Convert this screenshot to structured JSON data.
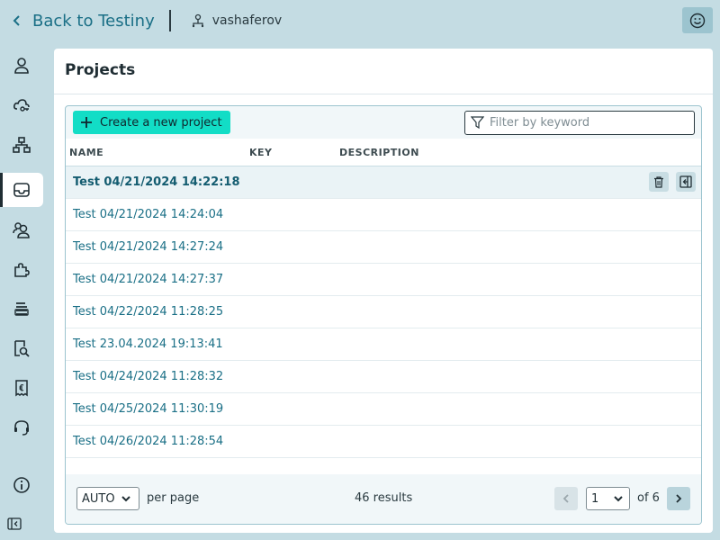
{
  "topbar": {
    "back_label": "Back to Testiny",
    "username": "vashaferov"
  },
  "sidebar": {
    "items": [
      {
        "name": "profile",
        "icon": "person-icon",
        "active": false
      },
      {
        "name": "cloud-key",
        "icon": "cloud-key-icon",
        "active": false
      },
      {
        "name": "organization",
        "icon": "hierarchy-icon",
        "active": false
      },
      {
        "name": "projects",
        "icon": "inbox-icon",
        "active": true
      },
      {
        "name": "users",
        "icon": "users-icon",
        "active": false
      },
      {
        "name": "integrations",
        "icon": "puzzle-icon",
        "active": false
      },
      {
        "name": "fields",
        "icon": "list-icon",
        "active": false
      },
      {
        "name": "audit",
        "icon": "search-document-icon",
        "active": false
      },
      {
        "name": "billing",
        "icon": "receipt-icon",
        "active": false
      },
      {
        "name": "support",
        "icon": "headset-icon",
        "active": false
      },
      {
        "name": "info",
        "icon": "info-icon",
        "active": false
      }
    ]
  },
  "main": {
    "title": "Projects",
    "create_label": "Create a new project",
    "filter_placeholder": "Filter by keyword",
    "columns": [
      "NAME",
      "KEY",
      "DESCRIPTION"
    ],
    "rows": [
      {
        "name": "Test 04/21/2024 14:22:18",
        "key": "",
        "description": ""
      },
      {
        "name": "Test 04/21/2024 14:24:04",
        "key": "",
        "description": ""
      },
      {
        "name": "Test 04/21/2024 14:27:24",
        "key": "",
        "description": ""
      },
      {
        "name": "Test 04/21/2024 14:27:37",
        "key": "",
        "description": ""
      },
      {
        "name": "Test 04/22/2024 11:28:25",
        "key": "",
        "description": ""
      },
      {
        "name": "Test 23.04.2024 19:13:41",
        "key": "",
        "description": ""
      },
      {
        "name": "Test 04/24/2024 11:28:32",
        "key": "",
        "description": ""
      },
      {
        "name": "Test 04/25/2024 11:30:19",
        "key": "",
        "description": ""
      },
      {
        "name": "Test 04/26/2024 11:28:54",
        "key": "",
        "description": ""
      }
    ]
  },
  "pagination": {
    "per_page_value": "AUTO",
    "per_page_label": "per page",
    "results": "46 results",
    "page_value": "1",
    "of_pages": "of 6"
  },
  "colors": {
    "background": "#c4dce3",
    "accent_button": "#12ddc6",
    "link": "#1a6f86"
  }
}
